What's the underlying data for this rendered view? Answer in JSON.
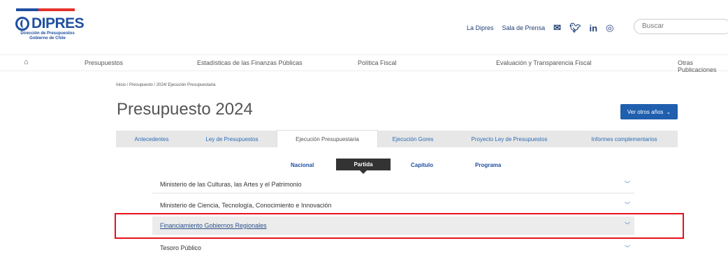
{
  "logo": {
    "name": "DIPRES",
    "subtitle_line1": "Dirección de Presupuestos",
    "subtitle_line2": "Gobierno de Chile"
  },
  "top_links": [
    "La Dipres",
    "Sala de Prensa"
  ],
  "search": {
    "placeholder": "Buscar"
  },
  "nav": [
    "Presupuestos",
    "Estadísticas de las Finanzas Públicas",
    "Política Fiscal",
    "Evaluación y Transparencia Fiscal",
    "Otras Publicaciones"
  ],
  "breadcrumb": "Inicio / Presupuesto / 2024/ Ejecución Presupuestaria",
  "page_title": "Presupuesto 2024",
  "other_years_button": "Ver otros años",
  "tabs": [
    "Antecedentes",
    "Ley de Presupuestos",
    "Ejecución Presupuestaria",
    "Ejecución Gores",
    "Proyecto Ley de Presupuestos",
    "Informes complementarios"
  ],
  "subtabs": [
    "Nacional",
    "Partida",
    "Capítulo",
    "Programa"
  ],
  "rows": [
    "Ministerio de las Culturas, las Artes y el Patrimonio",
    "Ministerio de Ciencia, Tecnología, Conocimiento e Innovación",
    "Financiamiento Gobiernos Regionales",
    "Tesoro Público"
  ],
  "colors": {
    "brand_blue": "#1f4fa0",
    "flag_red": "#e4322b",
    "highlight_box": "#e5121b",
    "button_blue": "#1f5fae"
  }
}
